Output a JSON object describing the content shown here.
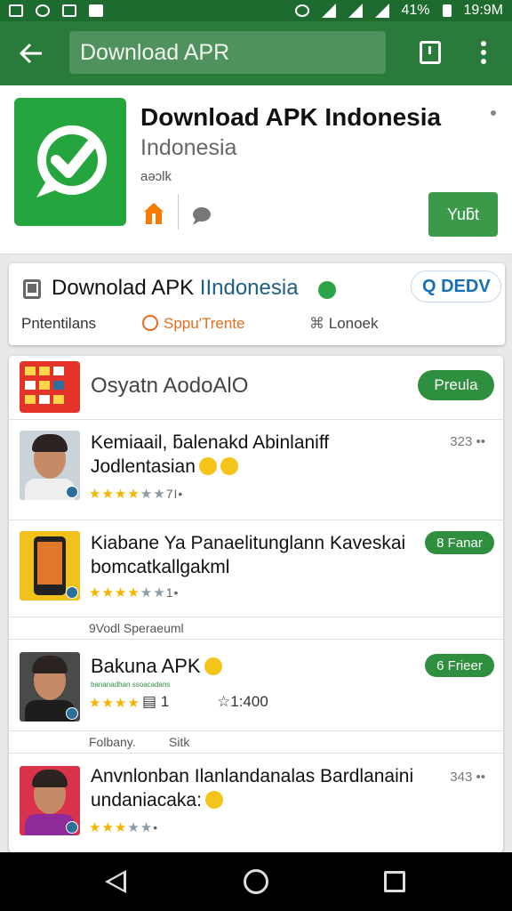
{
  "status_bar": {
    "battery": "41%",
    "time": "19:9M"
  },
  "toolbar": {
    "search_text": "Download APR"
  },
  "app": {
    "title": "Download APK Indonesia",
    "subtitle": "Indonesia",
    "small_text": "aəɔlk",
    "install_label": "Yuƃt"
  },
  "card2": {
    "title_part1": "Downolad APK ",
    "title_part2": "IIndonesia",
    "search_label": "Q  DEDV",
    "tab1": "Pntentilans",
    "tab2": "Sppu'Trente",
    "tab3": "Lonoek"
  },
  "list": {
    "header_title": "Osyatn AodoAlO",
    "header_button": "Preula",
    "items": [
      {
        "title_line1": "Kemiaail, ƃalenakd Abinlaniff",
        "title_line2": "Jodlentasian",
        "meta": "323 ••",
        "stars": "★★★★★★",
        "stars_tail": "7I•"
      },
      {
        "title_line1": "Kiabane Ya Panaelitunglann Kaveskai",
        "title_line2": "bomcatkallgakml",
        "button": "8 Fanar",
        "stars": "★★★★★★",
        "stars_tail": "1•"
      }
    ],
    "subheader": "9Vodl Speraeuml",
    "item3": {
      "title": "Bakuna APK",
      "tagline": "bananadhan ssoacadans",
      "button": "6 Frieer",
      "stars": "★★★★",
      "count1": "1",
      "count2": "1:400"
    },
    "subheader2_left": "Folbany.",
    "subheader2_right": "Sitk",
    "item4": {
      "title_line1": "Anvnlonban Ilanlandanalas Bardlanaini",
      "title_line2": "undaniacaka:",
      "meta": "343 ••",
      "stars": "★★★★★",
      "stars_tail": "•"
    }
  }
}
